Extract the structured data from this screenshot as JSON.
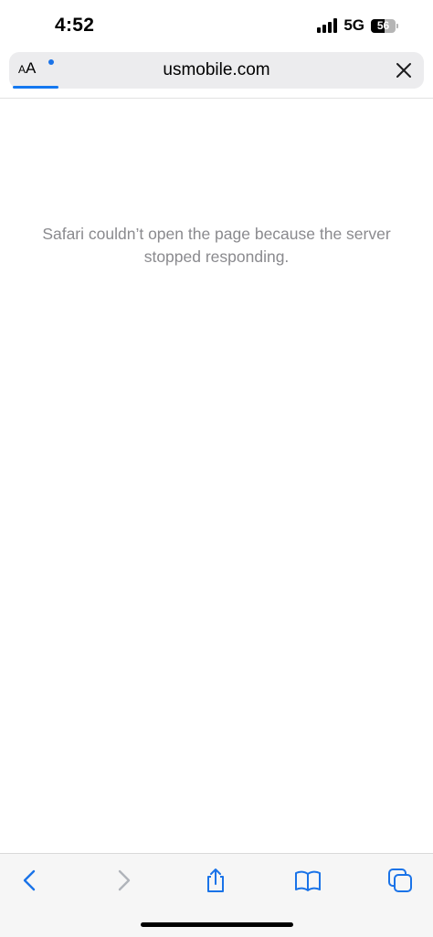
{
  "status_bar": {
    "time": "4:52",
    "network": "5G",
    "battery_level": "56",
    "battery_fraction": 0.56
  },
  "address_bar": {
    "url": "usmobile.com",
    "aa_small": "A",
    "aa_large": "A",
    "load_progress_fraction": 0.11,
    "accent_color": "#1478f0"
  },
  "page": {
    "error_message": "Safari couldn’t open the page because the server stopped responding."
  },
  "toolbar": {
    "icons": [
      "back-icon",
      "forward-icon",
      "share-icon",
      "bookmarks-icon",
      "tabs-icon"
    ],
    "active_color": "#1a73e8",
    "disabled_color": "#b0b4ba"
  }
}
